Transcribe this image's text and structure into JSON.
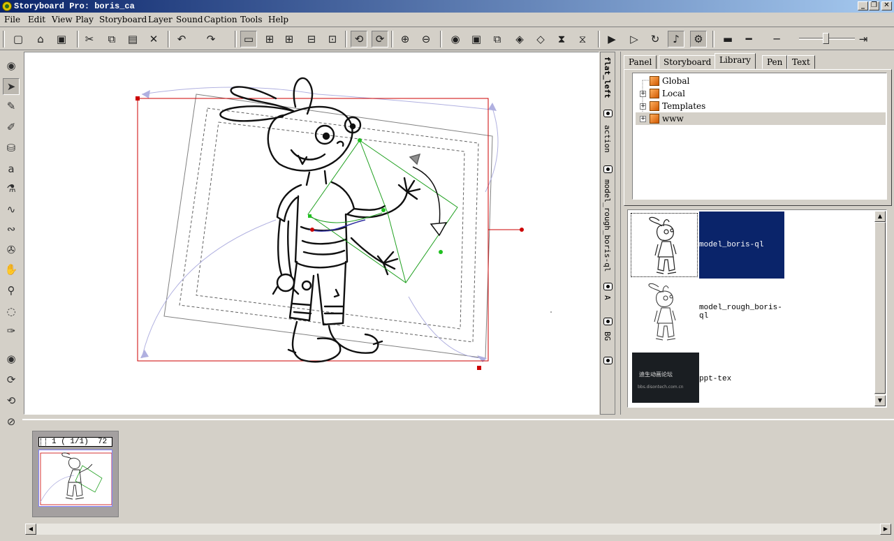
{
  "window": {
    "title": "Storyboard Pro: boris_ca",
    "controls": [
      "_",
      "❐",
      "✕"
    ]
  },
  "menu": [
    "File",
    "Edit",
    "View",
    "Play",
    "Storyboard",
    "Layer",
    "Sound",
    "Caption",
    "Tools",
    "Help"
  ],
  "toolbar": {
    "buttons": [
      {
        "name": "new-icon",
        "glyph": "▢"
      },
      {
        "name": "open-icon",
        "glyph": "⌂"
      },
      {
        "name": "save-icon",
        "glyph": "▣"
      },
      {
        "name": "cut-icon",
        "glyph": "✂"
      },
      {
        "name": "copy-icon",
        "glyph": "⧉"
      },
      {
        "name": "paste-icon",
        "glyph": "▤"
      },
      {
        "name": "delete-icon",
        "glyph": "✕"
      },
      {
        "name": "undo-icon",
        "glyph": "↶"
      },
      {
        "name": "redo-icon",
        "glyph": "↷"
      },
      {
        "name": "onion-skin-icon",
        "glyph": "▭"
      },
      {
        "name": "light-table-icon",
        "glyph": "⊞"
      },
      {
        "name": "grid-icon",
        "glyph": "⊞"
      },
      {
        "name": "thumbnails-icon",
        "glyph": "⊟"
      },
      {
        "name": "layout-icon",
        "glyph": "⊡"
      },
      {
        "name": "select-mode-icon",
        "glyph": "⟲"
      },
      {
        "name": "transform-mode-icon",
        "glyph": "⟳"
      },
      {
        "name": "zoom-in-icon",
        "glyph": "⊕"
      },
      {
        "name": "zoom-out-icon",
        "glyph": "⊖"
      },
      {
        "name": "view-icon",
        "glyph": "◉"
      },
      {
        "name": "new-panel-icon",
        "glyph": "▣"
      },
      {
        "name": "duplicate-panel-icon",
        "glyph": "⧉"
      },
      {
        "name": "rotate-panel-icon",
        "glyph": "◈"
      },
      {
        "name": "panel-ops-icon",
        "glyph": "◇"
      },
      {
        "name": "split-icon",
        "glyph": "⧗"
      },
      {
        "name": "merge-icon",
        "glyph": "⧖"
      },
      {
        "name": "play-icon",
        "glyph": "▶"
      },
      {
        "name": "play-scene-icon",
        "glyph": "▷"
      },
      {
        "name": "loop-icon",
        "glyph": "↻"
      },
      {
        "name": "sound-icon",
        "glyph": "♪"
      },
      {
        "name": "settings-icon",
        "glyph": "⚙"
      },
      {
        "name": "stroke-thick-icon",
        "glyph": "▬"
      },
      {
        "name": "stroke-medium-icon",
        "glyph": "━"
      },
      {
        "name": "stroke-thin-icon",
        "glyph": "─"
      },
      {
        "name": "slider-arrow-icon",
        "glyph": "⇥"
      }
    ]
  },
  "tools": [
    {
      "name": "view-toggle-icon",
      "glyph": "◉"
    },
    {
      "name": "select-tool-icon",
      "glyph": "➤"
    },
    {
      "name": "brush-tool-icon",
      "glyph": "✎"
    },
    {
      "name": "pencil-tool-icon",
      "glyph": "✐"
    },
    {
      "name": "paint-tool-icon",
      "glyph": "⛁"
    },
    {
      "name": "text-tool-icon",
      "glyph": "a"
    },
    {
      "name": "eyedropper-tool-icon",
      "glyph": "⚗"
    },
    {
      "name": "contour-tool-icon",
      "glyph": "∿"
    },
    {
      "name": "curve-tool-icon",
      "glyph": "∾"
    },
    {
      "name": "camera-tool-icon",
      "glyph": "✇"
    },
    {
      "name": "hand-tool-icon",
      "glyph": "✋"
    },
    {
      "name": "zoom-tool-icon",
      "glyph": "⚲"
    },
    {
      "name": "lasso-tool-icon",
      "glyph": "◌"
    },
    {
      "name": "cutter-tool-icon",
      "glyph": "✑"
    },
    {
      "name": "view-toggle-2-icon",
      "glyph": "◉"
    },
    {
      "name": "camera-pan-icon",
      "glyph": "⟳"
    },
    {
      "name": "camera-rotate-icon",
      "glyph": "⟲"
    },
    {
      "name": "reset-icon",
      "glyph": "⊘"
    }
  ],
  "layers": [
    {
      "label": "flat_left"
    },
    {
      "label": "action"
    },
    {
      "label": "model_rough_boris-ql"
    },
    {
      "label": "A"
    },
    {
      "label": "BG"
    }
  ],
  "right_panel": {
    "tabs": [
      "Panel",
      "Storyboard",
      "Library",
      "Pen",
      "Text"
    ],
    "active_tab": "Library",
    "tree": [
      {
        "label": "Global",
        "expandable": false,
        "selected": false
      },
      {
        "label": "Local",
        "expandable": true,
        "selected": false
      },
      {
        "label": "Templates",
        "expandable": true,
        "selected": false
      },
      {
        "label": "www",
        "expandable": true,
        "selected": true
      }
    ],
    "library_items": [
      {
        "label": "model_boris-ql",
        "selected": true,
        "thumb": "sketch"
      },
      {
        "label": "model_rough_boris-ql",
        "selected": false,
        "thumb": "sketch"
      },
      {
        "label": "ppt-tex",
        "selected": false,
        "thumb": "dark",
        "thumb_text_1": "迪生动画论坛",
        "thumb_text_2": "bbs.disontech.com.cn"
      }
    ]
  },
  "filmstrip": {
    "panels": [
      {
        "header": "1 ( 1/1)  72"
      }
    ]
  },
  "colors": {
    "accent_blue": "#0a246a",
    "selection_red": "#cc0000",
    "pivot_green": "#00a000"
  }
}
